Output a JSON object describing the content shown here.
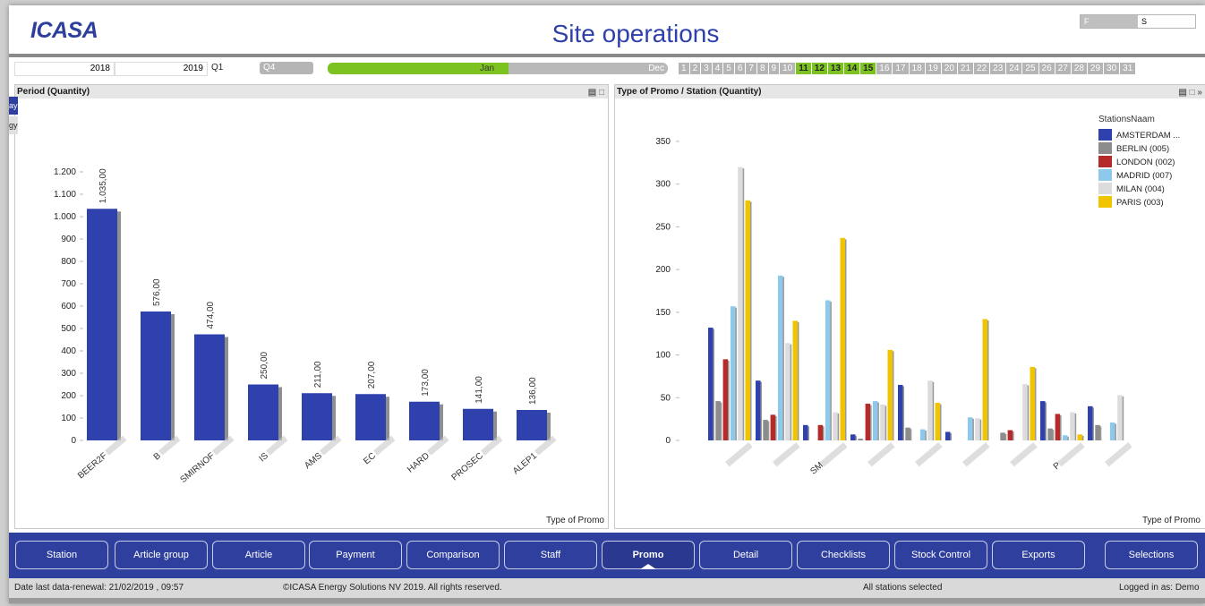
{
  "header": {
    "logo": "ICASA",
    "title": "Site operations",
    "field_f": "F",
    "field_s": "S"
  },
  "period": {
    "year_from": "2018",
    "year_to": "2019",
    "quarter_from": "Q1",
    "quarter_to": "Q4",
    "month_selected": "Jan",
    "month_end": "Dec",
    "days": [
      "1",
      "2",
      "3",
      "4",
      "5",
      "6",
      "7",
      "8",
      "9",
      "10",
      "11",
      "12",
      "13",
      "14",
      "15",
      "16",
      "17",
      "18",
      "19",
      "20",
      "21",
      "22",
      "23",
      "24",
      "25",
      "26",
      "27",
      "28",
      "29",
      "30",
      "31"
    ],
    "selected_days": [
      "11",
      "12",
      "13",
      "14",
      "15"
    ]
  },
  "side_tabs": [
    "ay",
    "gy"
  ],
  "left_panel": {
    "title": "Period (Quantity)",
    "x_axis_title": "Type of Promo"
  },
  "right_panel": {
    "title": "Type of Promo / Station (Quantity)",
    "x_axis_title": "Type of Promo",
    "legend_title": "StationsNaam"
  },
  "chart_data": [
    {
      "type": "bar",
      "title": "Period (Quantity)",
      "xlabel": "Type of Promo",
      "ylabel": "",
      "ylim": [
        0,
        1200
      ],
      "yticks": [
        "0",
        "100",
        "200",
        "300",
        "400",
        "500",
        "600",
        "700",
        "800",
        "900",
        "1.000",
        "1.100",
        "1.200"
      ],
      "categories": [
        "BEER2F",
        "B",
        "SMIRNOF",
        "IS",
        "AMS",
        "EC",
        "HARD",
        "PROSEC",
        "ALEP1"
      ],
      "values": [
        1035,
        576,
        474,
        250,
        211,
        207,
        173,
        141,
        136
      ],
      "value_labels": [
        "1.035,00",
        "576,00",
        "474,00",
        "250,00",
        "211,00",
        "207,00",
        "173,00",
        "141,00",
        "136,00"
      ],
      "colors": {
        "bar": "#2f41ad",
        "shadow": "#8f8f8f"
      }
    },
    {
      "type": "bar",
      "title": "Type of Promo / Station (Quantity)",
      "xlabel": "Type of Promo",
      "ylim": [
        0,
        350
      ],
      "yticks": [
        "0",
        "50",
        "100",
        "150",
        "200",
        "250",
        "300",
        "350"
      ],
      "categories": [
        "",
        "",
        "SM",
        "",
        "",
        "",
        "",
        "P",
        ""
      ],
      "legend_title": "StationsNaam",
      "series": [
        {
          "name": "AMSTERDAM ...",
          "color": "#2f41ad",
          "values": [
            132,
            70,
            18,
            7,
            65,
            10,
            0,
            46,
            40
          ]
        },
        {
          "name": "BERLIN (005)",
          "color": "#8c8c8c",
          "values": [
            46,
            24,
            0,
            2,
            15,
            0,
            9,
            14,
            18
          ]
        },
        {
          "name": "LONDON (002)",
          "color": "#b52a2a",
          "values": [
            95,
            30,
            18,
            43,
            0,
            0,
            12,
            31,
            0
          ]
        },
        {
          "name": "MADRID (007)",
          "color": "#8ec9ec",
          "values": [
            157,
            193,
            164,
            46,
            13,
            27,
            0,
            6,
            21
          ]
        },
        {
          "name": "MILAN (004)",
          "color": "#dcdcdc",
          "values": [
            320,
            114,
            33,
            42,
            70,
            26,
            66,
            33,
            53
          ]
        },
        {
          "name": "PARIS (003)",
          "color": "#f1c400",
          "values": [
            281,
            140,
            237,
            106,
            44,
            142,
            86,
            7,
            0
          ]
        }
      ]
    }
  ],
  "nav": {
    "buttons": [
      "Station",
      "Article group",
      "Article",
      "Payment",
      "Comparison",
      "Staff",
      "Promo",
      "Detail",
      "Checklists",
      "Stock Control",
      "Exports",
      "Selections"
    ],
    "active": "Promo"
  },
  "status": {
    "last_renewal": "Date last data-renewal:  21/02/2019 , 09:57",
    "copyright": "©ICASA Energy Solutions NV 2019. All rights reserved.",
    "stations": "All stations selected",
    "logged_in": "Logged in as:  Demo"
  }
}
